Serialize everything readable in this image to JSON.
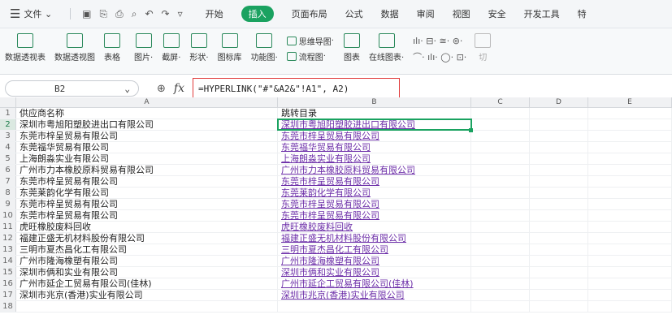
{
  "menubar": {
    "file": "文件",
    "tabs": [
      "开始",
      "插入",
      "页面布局",
      "公式",
      "数据",
      "审阅",
      "视图",
      "安全",
      "开发工具",
      "特"
    ],
    "active_tab": "插入"
  },
  "ribbon": {
    "large": [
      "数据透视表",
      "数据透视图",
      "表格",
      "图片",
      "截屏",
      "形状",
      "图标库",
      "功能图"
    ],
    "small1": [
      "思维导图",
      "流程图"
    ],
    "large2": [
      "图表",
      "在线图表"
    ],
    "icons_row1": "ılı· ⊟· ≅· ⊚·",
    "icons_row2": "⌒· ılı· ◯· ⊡·",
    "edge": "切"
  },
  "formula_bar": {
    "name_box": "B2",
    "formula": "=HYPERLINK(\"#\"&A2&\"!A1\", A2)"
  },
  "columns": [
    "A",
    "B",
    "C",
    "D",
    "E"
  ],
  "rows": [
    {
      "n": "1",
      "a": "供应商名称",
      "b": "跳转目录"
    },
    {
      "n": "2",
      "a": "深圳市粤旭阳塑胶进出口有限公司",
      "b": "深圳市粤旭阳塑胶进出口有限公司"
    },
    {
      "n": "3",
      "a": "东莞市梓呈贸易有限公司",
      "b": "东莞市梓呈贸易有限公司"
    },
    {
      "n": "4",
      "a": "东莞福华贸易有限公司",
      "b": "东莞福华贸易有限公司"
    },
    {
      "n": "5",
      "a": "上海朗淼实业有限公司",
      "b": "上海朗淼实业有限公司"
    },
    {
      "n": "6",
      "a": "广州市力本橡胶原料贸易有限公司",
      "b": "广州市力本橡胶原料贸易有限公司"
    },
    {
      "n": "7",
      "a": "东莞市梓呈贸易有限公司",
      "b": "东莞市梓呈贸易有限公司"
    },
    {
      "n": "8",
      "a": "东莞莱韵化学有限公司",
      "b": "东莞莱韵化学有限公司"
    },
    {
      "n": "9",
      "a": "东莞市梓呈贸易有限公司",
      "b": "东莞市梓呈贸易有限公司"
    },
    {
      "n": "10",
      "a": "东莞市梓呈贸易有限公司",
      "b": "东莞市梓呈贸易有限公司"
    },
    {
      "n": "11",
      "a": "虎旺橡胶废料回收",
      "b": "虎旺橡胶废料回收"
    },
    {
      "n": "12",
      "a": "福建正盛无机材料股份有限公司",
      "b": "福建正盛无机材料股份有限公司"
    },
    {
      "n": "13",
      "a": "三明市夏杰昌化工有限公司",
      "b": "三明市夏杰昌化工有限公司"
    },
    {
      "n": "14",
      "a": "广州市隆海橡塑有限公司",
      "b": "广州市隆海橡塑有限公司"
    },
    {
      "n": "15",
      "a": "深圳市俩和实业有限公司",
      "b": "深圳市俩和实业有限公司"
    },
    {
      "n": "16",
      "a": "广州市延企工贸易有限公司(佳林)",
      "b": "广州市延企工贸易有限公司(佳林)"
    },
    {
      "n": "17",
      "a": "深圳市兆京(香港)实业有限公司",
      "b": "深圳市兆京(香港)实业有限公司"
    },
    {
      "n": "18",
      "a": "",
      "b": ""
    }
  ]
}
